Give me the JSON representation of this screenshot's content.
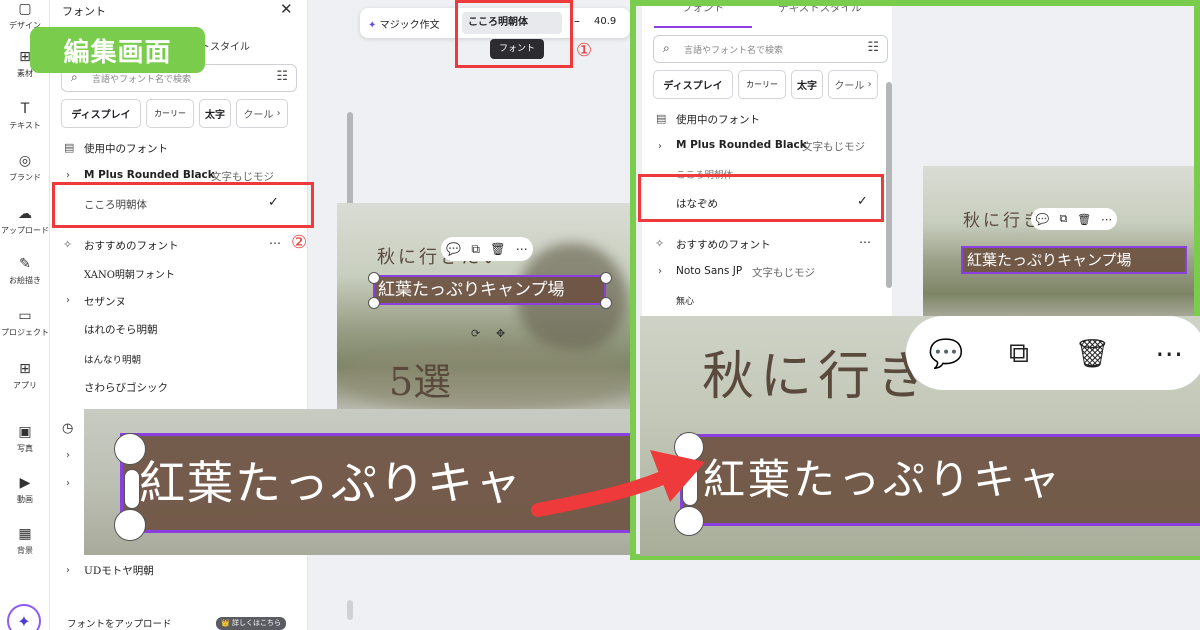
{
  "rail": [
    {
      "icon": "design-icon",
      "label": "デザイン",
      "glyph": "▢"
    },
    {
      "icon": "elements-icon",
      "label": "素材",
      "glyph": "⊞"
    },
    {
      "icon": "text-icon",
      "label": "テキスト",
      "glyph": "T"
    },
    {
      "icon": "brand-icon",
      "label": "ブランド",
      "glyph": "◎"
    },
    {
      "icon": "upload-icon",
      "label": "アップロード",
      "glyph": "☁"
    },
    {
      "icon": "draw-icon",
      "label": "お絵描き",
      "glyph": "✎"
    },
    {
      "icon": "project-icon",
      "label": "プロジェクト",
      "glyph": "▭"
    },
    {
      "icon": "apps-icon",
      "label": "アプリ",
      "glyph": "⊞"
    },
    {
      "icon": "photo-icon",
      "label": "写真",
      "glyph": "▣"
    },
    {
      "icon": "video-icon",
      "label": "動画",
      "glyph": "▶"
    },
    {
      "icon": "background-icon",
      "label": "背景",
      "glyph": "▦"
    }
  ],
  "label": "編集画面",
  "panel": {
    "title": "フォント",
    "tab2": "ストスタイル",
    "search_placeholder": "言語やフォント名で検索",
    "chips": [
      "ディスプレイ",
      "カーリー",
      "太字",
      "クール"
    ],
    "in_use_header": "使用中のフォント",
    "in_use_font": "M Plus Rounded Black",
    "in_use_sub": "文字もじモジ",
    "selected_font": "こころ明朝体",
    "recommended_header": "おすすめのフォント",
    "fonts": [
      "XANO明朝フォント",
      "セザンヌ",
      "はれのそら明朝",
      "はんなり明朝",
      "さわらびゴシック"
    ],
    "last_font": "UDモトヤ明朝",
    "upload": "フォントをアップロード",
    "upload_btn": "👑 詳しくはこちら"
  },
  "toolbar": {
    "magic": "マジック作文",
    "font": "こころ明朝体",
    "size": "40.9",
    "tooltip": "フォント"
  },
  "markers": {
    "one": "①",
    "two": "②"
  },
  "canvas": {
    "line1": "秋に行きたい",
    "line2": "紅葉たっぷりキャンプ場",
    "line3": "5選"
  },
  "zoom_text": "紅葉たっぷりキャ",
  "right": {
    "tab1": "フォント",
    "tab2": "テキストスタイル",
    "search_placeholder": "言語やフォント名で検索",
    "chips": [
      "ディスプレイ",
      "カーリー",
      "太字",
      "クール"
    ],
    "in_use_header": "使用中のフォント",
    "in_use_font": "M Plus Rounded Black",
    "in_use_sub": "文字もじモジ",
    "old_font": "こころ明朝体",
    "selected_font": "はなぞめ",
    "recommended_header": "おすすめのフォント",
    "rec_font": "Noto Sans JP",
    "rec_sub": "文字もじモジ",
    "rec_font2": "無心",
    "canvas_line1": "秋に行き",
    "canvas_line2": "紅葉たっぷりキャンプ場",
    "zoom_line1": "秋に行き",
    "zoom_line2": "紅葉たっぷりキャ"
  },
  "colors": {
    "green": "#7acc4c",
    "red": "#ee3a3a",
    "purple": "#8b3fe0"
  }
}
